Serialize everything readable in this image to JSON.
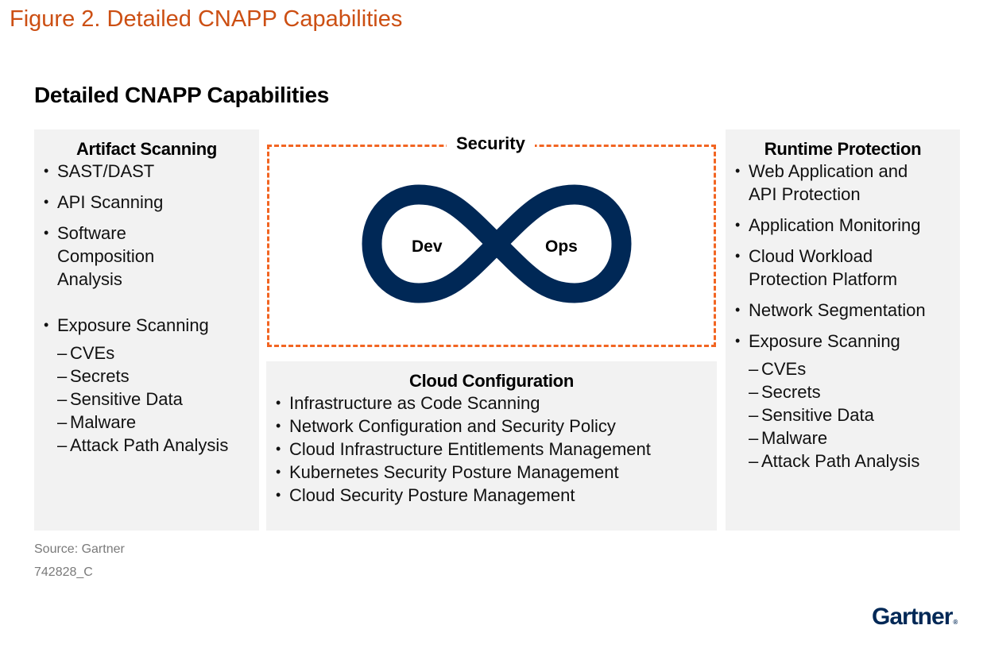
{
  "figure_title": "Figure 2. Detailed CNAPP Capabilities",
  "diagram_title": "Detailed CNAPP Capabilities",
  "colors": {
    "figure_title": "#cc4f13",
    "security_border": "#f26522",
    "infinity": "#002856",
    "panel_bg": "#f2f2f2",
    "logo": "#002856"
  },
  "artifact_scanning": {
    "heading": "Artifact Scanning",
    "items": [
      {
        "label": "SAST/DAST"
      },
      {
        "label": "API Scanning"
      },
      {
        "label": "Software Composition Analysis"
      },
      {
        "label": "Exposure Scanning",
        "sub": [
          "CVEs",
          "Secrets",
          "Sensitive Data",
          "Malware",
          "Attack Path Analysis"
        ]
      }
    ]
  },
  "security": {
    "label": "Security",
    "loop_left": "Dev",
    "loop_right": "Ops"
  },
  "cloud_configuration": {
    "heading": "Cloud Configuration",
    "items": [
      "Infrastructure as Code Scanning",
      "Network Configuration and Security Policy",
      "Cloud Infrastructure Entitlements Management",
      "Kubernetes Security Posture Management",
      "Cloud Security Posture Management"
    ]
  },
  "runtime_protection": {
    "heading": "Runtime Protection",
    "items": [
      {
        "label": "Web Application and API Protection"
      },
      {
        "label": "Application Monitoring"
      },
      {
        "label": "Cloud Workload Protection Platform"
      },
      {
        "label": "Network Segmentation"
      },
      {
        "label": "Exposure Scanning",
        "sub": [
          "CVEs",
          "Secrets",
          "Sensitive Data",
          "Malware",
          "Attack Path Analysis"
        ]
      }
    ]
  },
  "footer": {
    "source": "Source: Gartner",
    "code": "742828_C",
    "logo": "Gartner",
    "logo_mark": "®"
  }
}
